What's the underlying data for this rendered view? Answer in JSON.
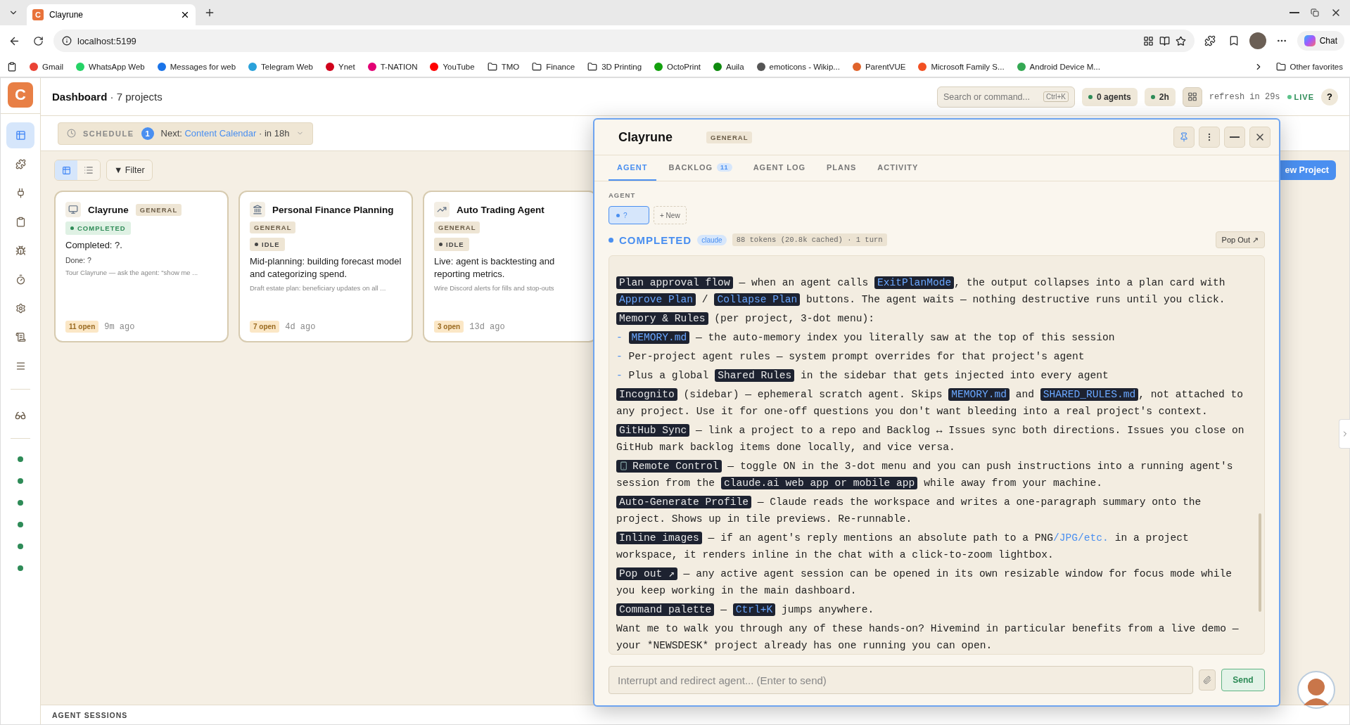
{
  "browser": {
    "tab": {
      "title": "Clayrune",
      "favicon": "C"
    },
    "address": "localhost:5199",
    "chat_button": "Chat",
    "bookmarks": [
      {
        "label": "Gmail",
        "kind": "site",
        "color": "#ea4335"
      },
      {
        "label": "WhatsApp Web",
        "kind": "site",
        "color": "#25d366"
      },
      {
        "label": "Messages for web",
        "kind": "site",
        "color": "#1a73e8"
      },
      {
        "label": "Telegram Web",
        "kind": "site",
        "color": "#2aa1da"
      },
      {
        "label": "Ynet",
        "kind": "site",
        "color": "#d0021b"
      },
      {
        "label": "T-NATION",
        "kind": "site",
        "color": "#e20074"
      },
      {
        "label": "YouTube",
        "kind": "site",
        "color": "#ff0000"
      },
      {
        "label": "TMO",
        "kind": "folder"
      },
      {
        "label": "Finance",
        "kind": "folder"
      },
      {
        "label": "3D Printing",
        "kind": "folder"
      },
      {
        "label": "OctoPrint",
        "kind": "site",
        "color": "#13a10e"
      },
      {
        "label": "Auila",
        "kind": "site",
        "color": "#0f8a0f"
      },
      {
        "label": "emoticons - Wikip...",
        "kind": "site",
        "color": "#555555"
      },
      {
        "label": "ParentVUE",
        "kind": "site",
        "color": "#e0632b"
      },
      {
        "label": "Microsoft Family S...",
        "kind": "site",
        "color": "#f25022"
      },
      {
        "label": "Android Device M...",
        "kind": "site",
        "color": "#34a853"
      }
    ],
    "other_favorites": "Other favorites"
  },
  "app": {
    "logo": "C",
    "breadcrumb": "**Dashboard** · 7 projects",
    "search": {
      "placeholder": "Search or command...",
      "shortcut": "Ctrl+K"
    },
    "agents_pill": "0 agents",
    "time_pill": "2h",
    "refresh": "refresh in 29s",
    "live": "LIVE",
    "help": "?",
    "sidebar": {
      "nav": [
        {
          "selected": true
        },
        {
          "selected": false
        },
        {
          "selected": false
        },
        {
          "selected": false
        },
        {
          "selected": false
        },
        {
          "selected": false
        },
        {
          "selected": false
        },
        {
          "selected": false
        },
        {
          "selected": false
        }
      ],
      "sessions": [
        {
          "color": "#2e8b57"
        },
        {
          "color": "#2e8b57"
        },
        {
          "color": "#2e8b57"
        },
        {
          "color": "#2e8b57"
        },
        {
          "color": "#2e8b57"
        },
        {
          "color": "#2e8b57"
        }
      ]
    },
    "schedule": {
      "label": "SCHEDULE",
      "count": "1",
      "prefix": "Next: ",
      "name": "Content Calendar",
      "suffix": " · in 18h"
    },
    "view_toggle": [
      {
        "selected": true
      },
      {
        "selected": false
      }
    ],
    "filter": "▼ Filter",
    "new_project": "ew Project",
    "cards": [
      {
        "title": "Clayrune",
        "tag": "GENERAL",
        "status": {
          "kind": "completed",
          "label": "COMPLETED"
        },
        "summary": "Completed: ?.",
        "detail": "Done: ?",
        "note": "Tour Clayrune — ask the agent: \"show me ...",
        "open": "11 open",
        "time": "9m ago"
      },
      {
        "title": "Personal Finance Planning",
        "tag": "GENERAL",
        "status": {
          "kind": "idle",
          "label": "IDLE"
        },
        "summary": "Mid-planning: building forecast model and categorizing spend.",
        "note": "Draft estate plan: beneficiary updates on all ...",
        "open": "7 open",
        "time": "4d ago"
      },
      {
        "title": "Auto Trading Agent",
        "tag": "GENERAL",
        "status": {
          "kind": "idle",
          "label": "IDLE"
        },
        "summary": "Live: agent is backtesting and reporting metrics.",
        "note": "Wire Discord alerts for fills and stop-outs",
        "open": "3 open",
        "time": "13d ago"
      }
    ],
    "bottom_bar": "AGENT SESSIONS"
  },
  "panel": {
    "title": "Clayrune",
    "tag": "GENERAL",
    "tabs": [
      {
        "label": "AGENT",
        "selected": true
      },
      {
        "label": "BACKLOG",
        "badge": "11",
        "selected": false
      },
      {
        "label": "AGENT LOG",
        "selected": false
      },
      {
        "label": "PLANS",
        "selected": false
      },
      {
        "label": "ACTIVITY",
        "selected": false
      }
    ],
    "section": "AGENT",
    "sessions": [
      {
        "label": "?",
        "selected": true
      }
    ],
    "new_session": "+ New",
    "status": "COMPLETED",
    "model": "claude",
    "usage": "88 tokens (20.8k cached) · 1 turn",
    "pop_out": "Pop Out ↗",
    "message": [
      [
        {
          "kind": "code",
          "t": "Plan approval flow"
        },
        {
          "kind": "plain",
          "t": " — when an agent calls "
        },
        {
          "kind": "code_blue",
          "t": "ExitPlanMode"
        },
        {
          "kind": "plain",
          "t": ", the output collapses into a plan card with "
        },
        {
          "kind": "code_blue",
          "t": "Approve Plan"
        },
        {
          "kind": "plain",
          "t": " / "
        },
        {
          "kind": "code_blue",
          "t": "Collapse Plan"
        },
        {
          "kind": "plain",
          "t": " buttons. The agent waits — nothing destructive runs until you click."
        }
      ],
      [
        {
          "kind": "code",
          "t": "Memory & Rules"
        },
        {
          "kind": "plain",
          "t": " (per project, 3-dot menu):"
        }
      ],
      [
        {
          "kind": "bullet",
          "t": "- "
        },
        {
          "kind": "code_blue",
          "t": "MEMORY.md"
        },
        {
          "kind": "plain",
          "t": " — the auto-memory index you literally saw at the top of this session"
        }
      ],
      [
        {
          "kind": "bullet",
          "t": "- "
        },
        {
          "kind": "plain",
          "t": "Per-project agent rules — system prompt overrides for that project's agent"
        }
      ],
      [
        {
          "kind": "bullet",
          "t": "- "
        },
        {
          "kind": "plain",
          "t": "Plus a global "
        },
        {
          "kind": "code",
          "t": "Shared Rules"
        },
        {
          "kind": "plain",
          "t": " in the sidebar that gets injected into every agent"
        }
      ],
      [
        {
          "kind": "code",
          "t": "Incognito"
        },
        {
          "kind": "plain",
          "t": " (sidebar) — ephemeral scratch agent. Skips "
        },
        {
          "kind": "code_blue",
          "t": "MEMORY.md"
        },
        {
          "kind": "plain",
          "t": " and "
        },
        {
          "kind": "code_blue",
          "t": "SHARED_RULES.md"
        },
        {
          "kind": "plain",
          "t": ", not attached to any project. Use it for one-off questions you don't want bleeding into a real project's context."
        }
      ],
      [
        {
          "kind": "code",
          "t": "GitHub Sync"
        },
        {
          "kind": "plain",
          "t": " — link a project to a repo and Backlog ↔ Issues sync both directions. Issues you close on GitHub mark backlog items done locally, and vice versa."
        }
      ],
      [
        {
          "kind": "code_icon",
          "t": "Remote Control"
        },
        {
          "kind": "plain",
          "t": " — toggle ON in the 3-dot menu and you can push instructions into a running agent's session from the "
        },
        {
          "kind": "code",
          "t": "claude.ai web app or mobile app"
        },
        {
          "kind": "plain",
          "t": " while away from your machine."
        }
      ],
      [
        {
          "kind": "code",
          "t": "Auto-Generate Profile"
        },
        {
          "kind": "plain",
          "t": " — Claude reads the workspace and writes a one-paragraph summary onto the project. Shows up in tile previews. Re-runnable."
        }
      ],
      [
        {
          "kind": "code",
          "t": "Inline images"
        },
        {
          "kind": "plain",
          "t": " — if an agent's reply mentions an absolute path to a PNG"
        },
        {
          "kind": "link",
          "t": "/JPG/etc."
        },
        {
          "kind": "plain",
          "t": " in a project workspace, it renders inline in the chat with a click-to-zoom lightbox."
        }
      ],
      [
        {
          "kind": "code",
          "t": "Pop out ↗"
        },
        {
          "kind": "plain",
          "t": " — any active agent session can be opened in its own resizable window for focus mode while you keep working in the main dashboard."
        }
      ],
      [
        {
          "kind": "code",
          "t": "Command palette"
        },
        {
          "kind": "plain",
          "t": " — "
        },
        {
          "kind": "code_blue",
          "t": "Ctrl+K"
        },
        {
          "kind": "plain",
          "t": " jumps anywhere."
        }
      ],
      [
        {
          "kind": "plain",
          "t": "Want me to walk you through any of these hands-on? Hivemind in particular benefits from a live demo — your *NEWSDESK* project already has one running you can open."
        }
      ]
    ],
    "input": {
      "placeholder": "Interrupt and redirect agent... (Enter to send)"
    },
    "send": "Send"
  }
}
